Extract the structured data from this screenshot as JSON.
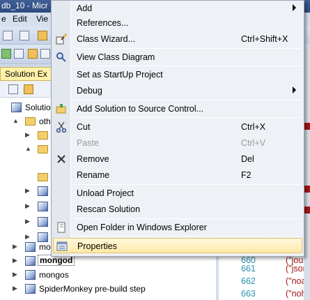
{
  "window": {
    "title_fragment": "db_10 - Micr"
  },
  "menubar": {
    "items": [
      "e",
      "Edit",
      "Vie"
    ]
  },
  "solution_explorer": {
    "header": "Solution Ex",
    "tree": [
      {
        "label": "Solutio",
        "type": "solution",
        "arrow": ""
      },
      {
        "label": "oth",
        "type": "folder",
        "arrow": "▲"
      },
      {
        "label": "",
        "type": "folder",
        "arrow": "▶"
      },
      {
        "label": "",
        "type": "folder",
        "arrow": "▲"
      },
      {
        "label": "",
        "type": "folder",
        "arrow": ""
      },
      {
        "label": "",
        "type": "project",
        "arrow": "▶"
      },
      {
        "label": "",
        "type": "project",
        "arrow": "▶"
      },
      {
        "label": "",
        "type": "project",
        "arrow": "▶"
      },
      {
        "label": "",
        "type": "project",
        "arrow": "▶"
      },
      {
        "label": "mo",
        "type": "project",
        "arrow": "▶"
      },
      {
        "label": "mongod",
        "type": "project",
        "arrow": "▶",
        "selected": true
      },
      {
        "label": "mongos",
        "type": "project",
        "arrow": "▶"
      },
      {
        "label": "SpiderMonkey pre-build step",
        "type": "project",
        "arrow": "▶"
      }
    ]
  },
  "code": {
    "lines": [
      {
        "num": "",
        "text": "\""
      },
      {
        "num": "",
        "text": "(\""
      },
      {
        "num": "",
        "text": "(\""
      },
      {
        "num": "",
        "text": "(\""
      },
      {
        "num": "",
        "text": "(\""
      },
      {
        "num": "",
        "text": "(\""
      },
      {
        "num": "",
        "text": "(\""
      },
      {
        "num": "",
        "text": "(\""
      },
      {
        "num": "",
        "text": "(\""
      },
      {
        "num": "",
        "text": "(\""
      },
      {
        "num": "660",
        "text": "(\"jour"
      },
      {
        "num": "661",
        "text": "(\"json"
      },
      {
        "num": "662",
        "text": "(\"noa"
      },
      {
        "num": "663",
        "text": "(\"noh"
      }
    ]
  },
  "context_menu": {
    "items": [
      {
        "label": "Add",
        "shortcut": "",
        "submenu": true,
        "icon": ""
      },
      {
        "label": "References...",
        "shortcut": "",
        "submenu": false,
        "icon": ""
      },
      {
        "label": "Class Wizard...",
        "shortcut": "Ctrl+Shift+X",
        "submenu": false,
        "icon": "class-wizard-icon"
      },
      {
        "label": "View Class Diagram",
        "shortcut": "",
        "submenu": false,
        "icon": "class-diagram-icon"
      },
      {
        "label": "Set as StartUp Project",
        "shortcut": "",
        "submenu": false,
        "icon": ""
      },
      {
        "label": "Debug",
        "shortcut": "",
        "submenu": true,
        "icon": ""
      },
      {
        "label": "Add Solution to Source Control...",
        "shortcut": "",
        "submenu": false,
        "icon": "source-control-icon"
      },
      {
        "label": "Cut",
        "shortcut": "Ctrl+X",
        "submenu": false,
        "icon": "scissors-icon"
      },
      {
        "label": "Paste",
        "shortcut": "Ctrl+V",
        "submenu": false,
        "icon": "",
        "disabled": true
      },
      {
        "label": "Remove",
        "shortcut": "Del",
        "submenu": false,
        "icon": "remove-x-icon"
      },
      {
        "label": "Rename",
        "shortcut": "F2",
        "submenu": false,
        "icon": ""
      },
      {
        "label": "Unload Project",
        "shortcut": "",
        "submenu": false,
        "icon": ""
      },
      {
        "label": "Rescan Solution",
        "shortcut": "",
        "submenu": false,
        "icon": ""
      },
      {
        "label": "Open Folder in Windows Explorer",
        "shortcut": "",
        "submenu": false,
        "icon": "open-folder-icon"
      },
      {
        "label": "Properties",
        "shortcut": "",
        "submenu": false,
        "icon": "properties-icon",
        "highlighted": true
      }
    ]
  },
  "colors": {
    "highlight_border": "#e5c365",
    "line_number": "#2b91af",
    "string": "#a31515"
  }
}
